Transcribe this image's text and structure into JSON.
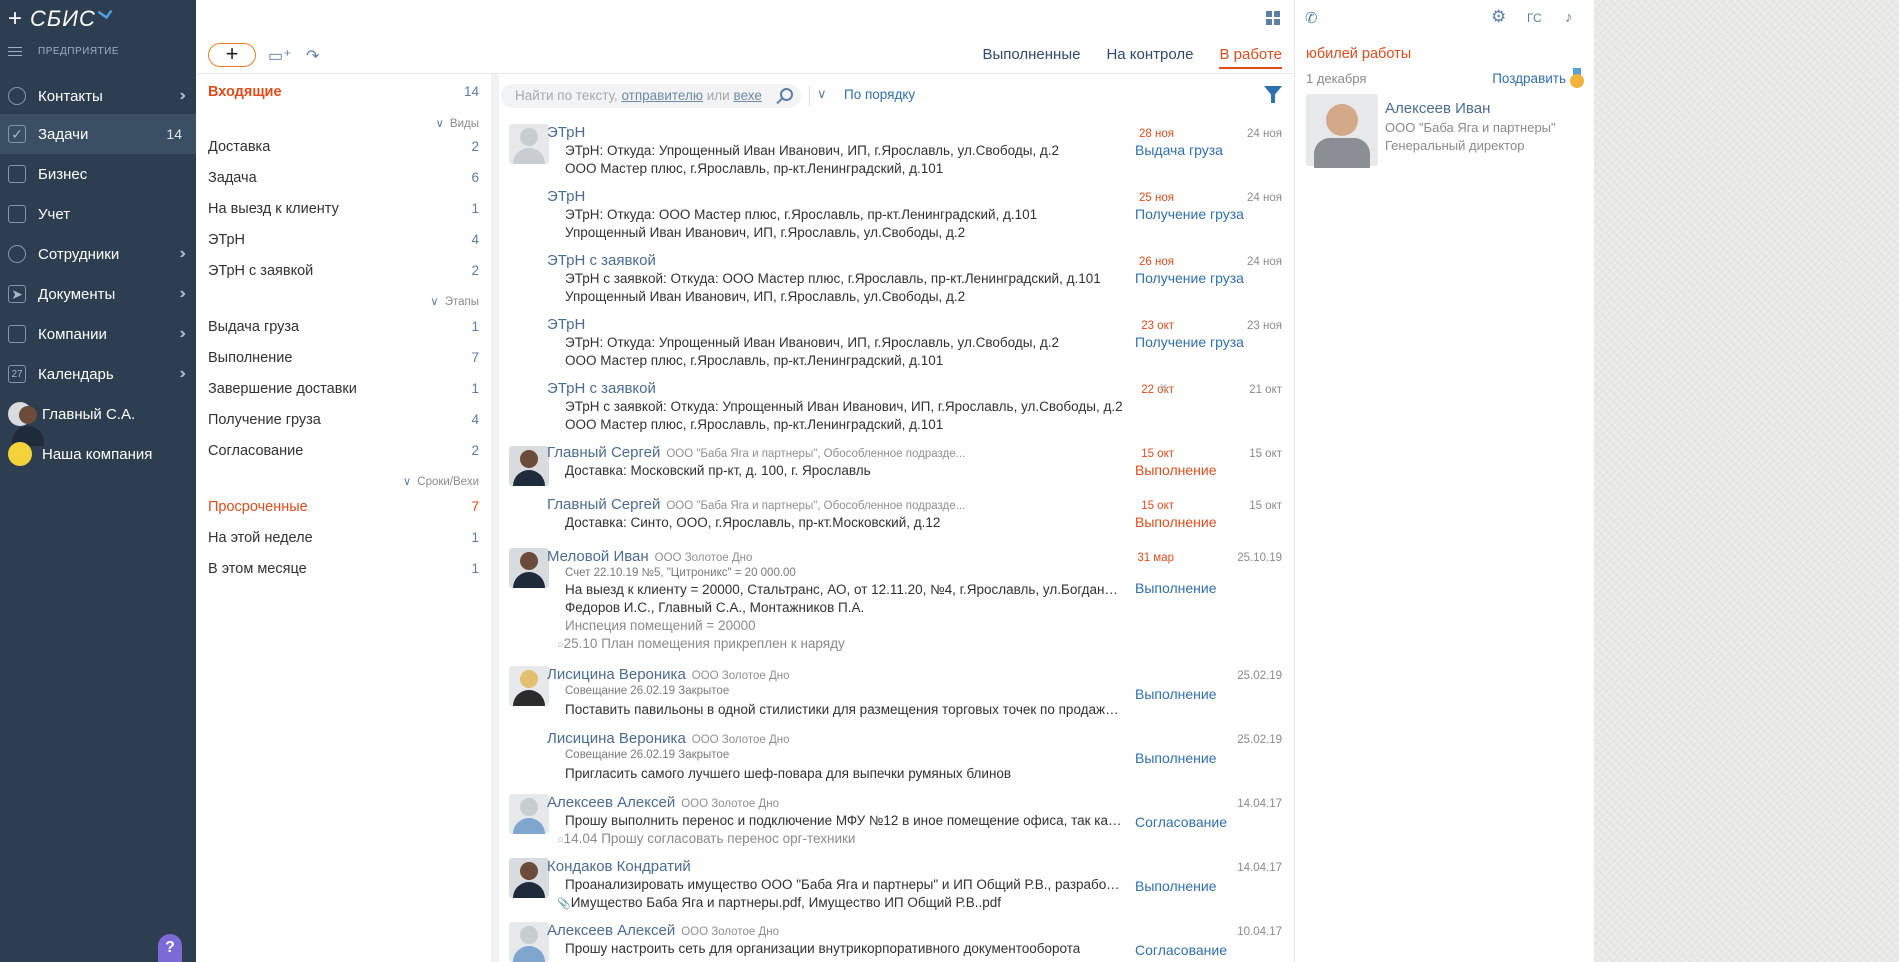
{
  "nav": {
    "logo": "СБИС",
    "enterprise": "ПРЕДПРИЯТИЕ",
    "items": [
      {
        "label": "Контакты",
        "icon": "chat-icon"
      },
      {
        "label": "Задачи",
        "icon": "tasks-icon",
        "count": "14"
      },
      {
        "label": "Бизнес",
        "icon": "briefcase-icon"
      },
      {
        "label": "Учет",
        "icon": "calculator-icon"
      },
      {
        "label": "Сотрудники",
        "icon": "people-icon"
      },
      {
        "label": "Документы",
        "icon": "send-icon"
      },
      {
        "label": "Компании",
        "icon": "buildings-icon"
      },
      {
        "label": "Календарь",
        "icon": "calendar-icon",
        "day": "27"
      },
      {
        "label": "Главный С.А.",
        "icon": "user-avatar"
      },
      {
        "label": "Наша компания",
        "icon": "company-logo"
      }
    ],
    "help": "?"
  },
  "toolbar": {
    "add": "+",
    "tabs": [
      "Выполненные",
      "На контроле",
      "В работе"
    ],
    "active_tab": "В работе"
  },
  "filters": {
    "inbox": {
      "label": "Входящие",
      "count": "14"
    },
    "group_types": "Виды",
    "types": [
      {
        "label": "Доставка",
        "count": "2"
      },
      {
        "label": "Задача",
        "count": "6"
      },
      {
        "label": "На выезд к клиенту",
        "count": "1"
      },
      {
        "label": "ЭТрН",
        "count": "4"
      },
      {
        "label": "ЭТрН с заявкой",
        "count": "2"
      }
    ],
    "group_stages": "Этапы",
    "stages": [
      {
        "label": "Выдача груза",
        "count": "1"
      },
      {
        "label": "Выполнение",
        "count": "7"
      },
      {
        "label": "Завершение доставки",
        "count": "1"
      },
      {
        "label": "Получение груза",
        "count": "4"
      },
      {
        "label": "Согласование",
        "count": "2"
      }
    ],
    "group_deadlines": "Сроки/Вехи",
    "deadlines": [
      {
        "label": "Просроченные",
        "count": "7"
      },
      {
        "label": "На этой неделе",
        "count": "1"
      },
      {
        "label": "В этом месяце",
        "count": "1"
      }
    ]
  },
  "search": {
    "placeholder_a": "Найти по тексту,",
    "placeholder_b": "отправителю",
    "placeholder_c": "или",
    "placeholder_d": "вехе",
    "sort": "По порядку"
  },
  "tasks": [
    {
      "title": "ЭТрН",
      "due": "28 ноя",
      "date": "24 ноя",
      "status": "Выдача груза",
      "lines": [
        "ЭТрН: Откуда: Упрощенный Иван Иванович, ИП, г.Ярославль, ул.Свободы, д.2",
        "ООО Мастер плюс, г.Ярославль, пр-кт.Ленинградский, д.101"
      ]
    },
    {
      "title": "ЭТрН",
      "due": "25 ноя",
      "date": "24 ноя",
      "status": "Получение груза",
      "lines": [
        "ЭТрН: Откуда: ООО Мастер плюс, г.Ярославль, пр-кт.Ленинградский, д.101",
        "Упрощенный Иван Иванович, ИП, г.Ярославль, ул.Свободы, д.2"
      ]
    },
    {
      "title": "ЭТрН с заявкой",
      "due": "26 ноя",
      "date": "24 ноя",
      "status": "Получение груза",
      "lines": [
        "ЭТрН с заявкой: Откуда: ООО Мастер плюс, г.Ярославль, пр-кт.Ленинградский, д.101",
        "Упрощенный Иван Иванович, ИП, г.Ярославль, ул.Свободы, д.2"
      ]
    },
    {
      "title": "ЭТрН",
      "due": "23 окт",
      "date": "23 ноя",
      "status": "Получение груза",
      "lines": [
        "ЭТрН: Откуда: Упрощенный Иван Иванович, ИП, г.Ярославль, ул.Свободы, д.2",
        "ООО Мастер плюс, г.Ярославль, пр-кт.Ленинградский, д.101"
      ]
    },
    {
      "title": "ЭТрН с заявкой",
      "due": "22 окт",
      "date": "21 окт",
      "status": "×",
      "lines": [
        "ЭТрН с заявкой: Откуда: Упрощенный Иван Иванович, ИП, г.Ярославль, ул.Свободы, д.2",
        "ООО Мастер плюс, г.Ярославль, пр-кт.Ленинградский, д.101"
      ]
    },
    {
      "title": "Главный Сергей",
      "org": "ООО \"Баба Яга и партнеры\", Обособленное подразде...",
      "due": "15 окт",
      "date": "15 окт",
      "status": "Выполнение",
      "lines": [
        "Доставка: Московский пр-кт, д. 100, г. Ярославль"
      ]
    },
    {
      "title": "Главный Сергей",
      "org": "ООО \"Баба Яга и партнеры\", Обособленное подразде...",
      "due": "15 окт",
      "date": "15 окт",
      "status": "Выполнение",
      "lines": [
        "Доставка: Синто, ООО, г.Ярославль, пр-кт.Московский, д.12"
      ]
    },
    {
      "title": "Меловой Иван",
      "org": "ООО Золотое Дно",
      "due": "31 мар",
      "date": "25.10.19",
      "status": "Выполнение",
      "sub": "Счет 22.10.19 №5, \"Цитроникс\" = 20 000.00",
      "lines": [
        "На выезд к клиенту = 20000, Стальтранс, АО, от 12.11.20, №4, г.Ярославль, ул.Богданови...",
        "Федоров И.С., Главный С.А., Монтажников П.А."
      ],
      "extra": "Инспеция помещений = 20000",
      "comment": "25.10 План помещения прикреплен к наряду"
    },
    {
      "title": "Лисицина Вероника",
      "org": "ООО Золотое Дно",
      "due": "",
      "date": "25.02.19",
      "status": "Выполнение",
      "sub": "Совещание 26.02.19 Закрытое",
      "lines": [
        "Поставить павильоны в одной стилистики для размещения торговых точек по продажи т..."
      ]
    },
    {
      "title": "Лисицина Вероника",
      "org": "ООО Золотое Дно",
      "due": "",
      "date": "25.02.19",
      "status": "Выполнение",
      "sub": "Совещание 26.02.19 Закрытое",
      "lines": [
        "Пригласить самого лучшего шеф-повара для выпечки румяных блинов"
      ]
    },
    {
      "title": "Алексеев Алексей",
      "org": "ООО Золотое Дно",
      "due": "",
      "date": "14.04.17",
      "status": "Согласование",
      "lines": [
        "Прошу выполнить перенос и подключение МФУ №12 в иное помещение офиса, так как ..."
      ],
      "comment": "14.04 Прошу согласовать перенос орг-техники"
    },
    {
      "title": "Кондаков Кондратий",
      "org": "",
      "due": "",
      "date": "14.04.17",
      "status": "Выполнение",
      "lines": [
        "Проанализировать имущество ООО \"Баба Яга и партнеры\" и ИП Общий Р.В., разработать..."
      ],
      "attach": "Имущество Баба Яга и партнеры.pdf, Имущество ИП Общий Р.В..pdf"
    },
    {
      "title": "Алексеев Алексей",
      "org": "ООО Золотое Дно",
      "due": "",
      "date": "10.04.17",
      "status": "Согласование",
      "lines": [
        "Прошу настроить сеть для организации внутрикорпоративного документооборота"
      ]
    }
  ],
  "right": {
    "title": "юбилей работы",
    "date": "1 декабря",
    "congratulate": "Поздравить",
    "person": {
      "name": "Алексеев Иван",
      "org": "ООО \"Баба Яга и партнеры\"",
      "position": "Генеральный директор"
    },
    "top_icons": [
      "phone-icon",
      "gear-icon",
      "initials-gs",
      "bell-icon"
    ],
    "initials": "ГС"
  },
  "colors": {
    "nav_bg": "#2c3e50",
    "accent": "#e04b1a",
    "link": "#2e6fb0"
  }
}
